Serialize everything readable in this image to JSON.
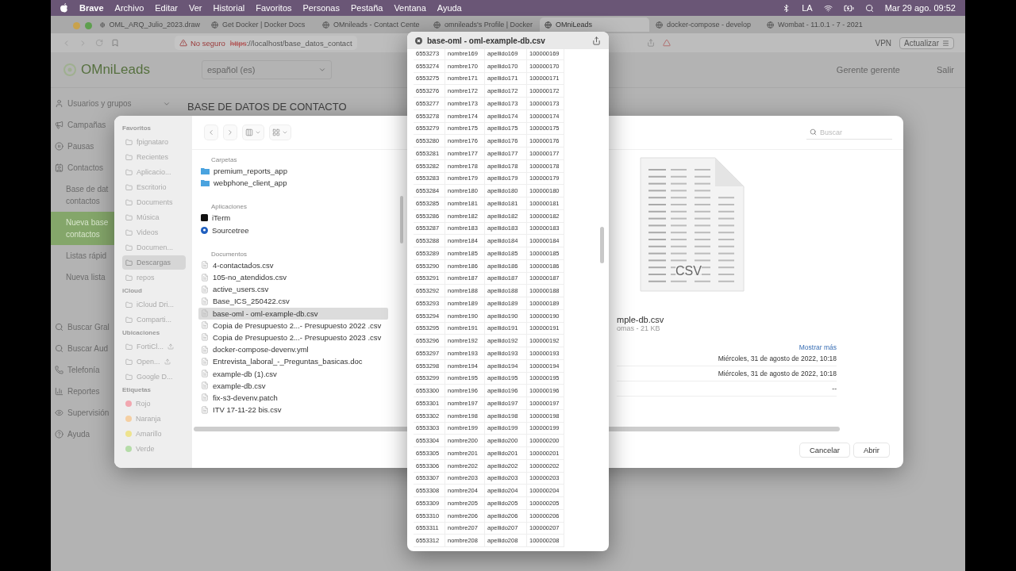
{
  "menu_bar": {
    "app": "Brave",
    "menus": [
      "Archivo",
      "Editar",
      "Ver",
      "Historial",
      "Favoritos",
      "Personas",
      "Pestaña",
      "Ventana",
      "Ayuda"
    ],
    "input_source": "LA",
    "clock": "Mar 29 ago.  09:52"
  },
  "browser_tabs": [
    {
      "title": "OML_ARQ_Julio_2023.draw",
      "selected": false
    },
    {
      "title": "Get Docker | Docker Docs",
      "selected": false
    },
    {
      "title": "OMnileads - Contact Cente",
      "selected": false
    },
    {
      "title": "omnileads's Profile | Docker",
      "selected": false
    },
    {
      "title": "OMniLeads",
      "selected": true
    },
    {
      "title": "docker-compose - develop",
      "selected": false
    },
    {
      "title": "Wombat - 11.0.1 - 7 - 2021",
      "selected": false
    }
  ],
  "address_bar": {
    "security": "No seguro",
    "scheme": "https",
    "url_rest": "://localhost/base_datos_contact",
    "vpn": "VPN",
    "update_button": "Actualizar"
  },
  "page": {
    "logo": "OMniLeads",
    "language_select": "español (es)",
    "user": "Gerente gerente",
    "logout": "Salir",
    "heading": "BASE DE DATOS DE CONTACTO",
    "sidebar": [
      {
        "label": "Usuarios y grupos",
        "expandable": true
      },
      {
        "label": "Campañas"
      },
      {
        "label": "Pausas"
      },
      {
        "label": "Contactos",
        "children": [
          {
            "lines": [
              "Base de dat",
              "contactos"
            ],
            "selected": false
          },
          {
            "lines": [
              "Nueva base",
              "contactos"
            ],
            "selected": true
          },
          {
            "lines": [
              "Listas rápid"
            ],
            "selected": false
          },
          {
            "lines": [
              "Nueva lista"
            ],
            "selected": false
          }
        ]
      },
      {
        "label": "Buscar Gral",
        "gap": true
      },
      {
        "label": "Buscar Aud"
      },
      {
        "label": "Telefonía"
      },
      {
        "label": "Reportes"
      },
      {
        "label": "Supervisión"
      },
      {
        "label": "Ayuda"
      }
    ]
  },
  "open_dialog": {
    "sidebar": [
      {
        "heading": "Favoritos",
        "items": [
          {
            "label": "fpignataro",
            "selected": false
          },
          {
            "label": "Recientes",
            "selected": false
          },
          {
            "label": "Aplicacio...",
            "selected": false
          },
          {
            "label": "Escritorio",
            "selected": false
          },
          {
            "label": "Documents",
            "selected": false
          },
          {
            "label": "Música",
            "selected": false
          },
          {
            "label": "Videos",
            "selected": false
          },
          {
            "label": "Documen...",
            "selected": false
          },
          {
            "label": "Descargas",
            "selected": true
          },
          {
            "label": "repos",
            "selected": false
          }
        ]
      },
      {
        "heading": "iCloud",
        "items": [
          {
            "label": "iCloud Dri...",
            "selected": false
          },
          {
            "label": "Comparti...",
            "selected": false
          }
        ]
      },
      {
        "heading": "Ubicaciones",
        "items": [
          {
            "label": "FortiCl...",
            "selected": false,
            "eject": true
          },
          {
            "label": "Open...",
            "selected": false,
            "eject": true
          },
          {
            "label": "Google D...",
            "selected": false
          }
        ]
      },
      {
        "heading": "Etiquetas",
        "tags": [
          {
            "label": "Rojo",
            "color": "#f2a7b0"
          },
          {
            "label": "Naranja",
            "color": "#f5cfa2"
          },
          {
            "label": "Amarillo",
            "color": "#eee38e"
          },
          {
            "label": "Verde",
            "color": "#b5dca8"
          }
        ]
      }
    ],
    "search_placeholder": "Buscar",
    "sections": [
      {
        "heading": "Carpetas",
        "items": [
          {
            "name": "premium_reports_app",
            "kind": "folder",
            "selected": false
          },
          {
            "name": "webphone_client_app",
            "kind": "folder",
            "selected": false
          }
        ]
      },
      {
        "heading": "Aplicaciones",
        "items": [
          {
            "name": "iTerm",
            "kind": "terminal",
            "selected": false
          },
          {
            "name": "Sourcetree",
            "kind": "app",
            "selected": false
          }
        ]
      },
      {
        "heading": "Documentos",
        "items": [
          {
            "name": "4-contactados.csv",
            "kind": "file",
            "selected": false
          },
          {
            "name": "105-no_atendidos.csv",
            "kind": "file",
            "selected": false
          },
          {
            "name": "active_users.csv",
            "kind": "file",
            "selected": false
          },
          {
            "name": "Base_ICS_250422.csv",
            "kind": "file",
            "selected": false
          },
          {
            "name": "base-oml - oml-example-db.csv",
            "kind": "file",
            "selected": true
          },
          {
            "name": "Copia de Presupuesto 2...- Presupuesto 2022 .csv",
            "kind": "file",
            "selected": false
          },
          {
            "name": "Copia de Presupuesto 2...- Presupuesto 2023 .csv",
            "kind": "file",
            "selected": false
          },
          {
            "name": "docker-compose-devenv.yml",
            "kind": "file",
            "selected": false
          },
          {
            "name": "Entrevista_laboral_-_Preguntas_basicas.doc",
            "kind": "file",
            "selected": false
          },
          {
            "name": "example-db (1).csv",
            "kind": "file",
            "selected": false
          },
          {
            "name": "example-db.csv",
            "kind": "file",
            "selected": false
          },
          {
            "name": "fix-s3-devenv.patch",
            "kind": "file",
            "selected": false
          },
          {
            "name": "ITV 17-11-22 bis.csv",
            "kind": "file",
            "selected": false
          }
        ]
      }
    ],
    "preview": {
      "thumbnail_label": "CSV",
      "name": "mple-db.csv",
      "info": "omas - 21 KB",
      "more_link": "Mostrar más",
      "details": [
        "Miércoles, 31 de agosto de 2022, 10:18",
        "Miércoles, 31 de agosto de 2022, 10:18",
        "--"
      ]
    },
    "buttons": [
      "Cancelar",
      "Abrir"
    ]
  },
  "quick_look": {
    "title": "base-oml - oml-example-db.csv",
    "rows": [
      [
        "6553273",
        "nombre169",
        "apellido169",
        "100000169"
      ],
      [
        "6553274",
        "nombre170",
        "apellido170",
        "100000170"
      ],
      [
        "6553275",
        "nombre171",
        "apellido171",
        "100000171"
      ],
      [
        "6553276",
        "nombre172",
        "apellido172",
        "100000172"
      ],
      [
        "6553277",
        "nombre173",
        "apellido173",
        "100000173"
      ],
      [
        "6553278",
        "nombre174",
        "apellido174",
        "100000174"
      ],
      [
        "6553279",
        "nombre175",
        "apellido175",
        "100000175"
      ],
      [
        "6553280",
        "nombre176",
        "apellido176",
        "100000176"
      ],
      [
        "6553281",
        "nombre177",
        "apellido177",
        "100000177"
      ],
      [
        "6553282",
        "nombre178",
        "apellido178",
        "100000178"
      ],
      [
        "6553283",
        "nombre179",
        "apellido179",
        "100000179"
      ],
      [
        "6553284",
        "nombre180",
        "apellido180",
        "100000180"
      ],
      [
        "6553285",
        "nombre181",
        "apellido181",
        "100000181"
      ],
      [
        "6553286",
        "nombre182",
        "apellido182",
        "100000182"
      ],
      [
        "6553287",
        "nombre183",
        "apellido183",
        "100000183"
      ],
      [
        "6553288",
        "nombre184",
        "apellido184",
        "100000184"
      ],
      [
        "6553289",
        "nombre185",
        "apellido185",
        "100000185"
      ],
      [
        "6553290",
        "nombre186",
        "apellido186",
        "100000186"
      ],
      [
        "6553291",
        "nombre187",
        "apellido187",
        "100000187"
      ],
      [
        "6553292",
        "nombre188",
        "apellido188",
        "100000188"
      ],
      [
        "6553293",
        "nombre189",
        "apellido189",
        "100000189"
      ],
      [
        "6553294",
        "nombre190",
        "apellido190",
        "100000190"
      ],
      [
        "6553295",
        "nombre191",
        "apellido191",
        "100000191"
      ],
      [
        "6553296",
        "nombre192",
        "apellido192",
        "100000192"
      ],
      [
        "6553297",
        "nombre193",
        "apellido193",
        "100000193"
      ],
      [
        "6553298",
        "nombre194",
        "apellido194",
        "100000194"
      ],
      [
        "6553299",
        "nombre195",
        "apellido195",
        "100000195"
      ],
      [
        "6553300",
        "nombre196",
        "apellido196",
        "100000196"
      ],
      [
        "6553301",
        "nombre197",
        "apellido197",
        "100000197"
      ],
      [
        "6553302",
        "nombre198",
        "apellido198",
        "100000198"
      ],
      [
        "6553303",
        "nombre199",
        "apellido199",
        "100000199"
      ],
      [
        "6553304",
        "nombre200",
        "apellido200",
        "100000200"
      ],
      [
        "6553305",
        "nombre201",
        "apellido201",
        "100000201"
      ],
      [
        "6553306",
        "nombre202",
        "apellido202",
        "100000202"
      ],
      [
        "6553307",
        "nombre203",
        "apellido203",
        "100000203"
      ],
      [
        "6553308",
        "nombre204",
        "apellido204",
        "100000204"
      ],
      [
        "6553309",
        "nombre205",
        "apellido205",
        "100000205"
      ],
      [
        "6553310",
        "nombre206",
        "apellido206",
        "100000206"
      ],
      [
        "6553311",
        "nombre207",
        "apellido207",
        "100000207"
      ],
      [
        "6553312",
        "nombre208",
        "apellido208",
        "100000208"
      ]
    ]
  }
}
